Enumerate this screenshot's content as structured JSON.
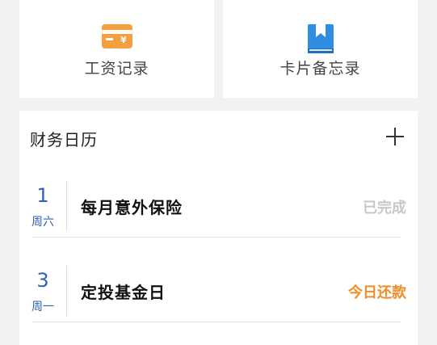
{
  "tiles": [
    {
      "label": "工资记录",
      "icon": "salary-card-icon",
      "color": "#f5a040"
    },
    {
      "label": "卡片备忘录",
      "icon": "bookmark-book-icon",
      "color": "#2f8de4"
    }
  ],
  "calendar": {
    "title": "财务日历",
    "add_icon": "plus-icon",
    "events": [
      {
        "day": "1",
        "weekday": "周六",
        "name": "每月意外保险",
        "status": "已完成"
      },
      {
        "day": "3",
        "weekday": "周一",
        "name": "定投基金日",
        "status": "今日还款"
      }
    ]
  },
  "colors": {
    "accent_blue": "#2f62b8",
    "status_done": "#c8c8c8",
    "status_due": "#f28c2a"
  }
}
